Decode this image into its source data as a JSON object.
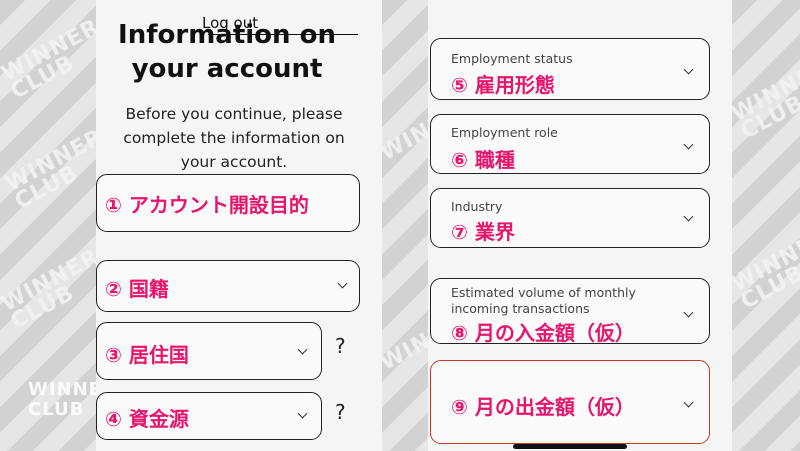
{
  "header": {
    "logout_label": "Log out",
    "title_line1": "Information on",
    "title_line2": "your account",
    "description": "Before you continue, please complete the information on your account."
  },
  "watermark": {
    "brand_lines": [
      "WINNER",
      "CLUB"
    ]
  },
  "left_fields": [
    {
      "marker": "①",
      "text": "アカウント開設目的"
    },
    {
      "marker": "②",
      "text": "国籍"
    },
    {
      "marker": "③",
      "text": "居住国",
      "help": "?"
    },
    {
      "marker": "④",
      "text": "資金源",
      "help": "?"
    }
  ],
  "right_fields": [
    {
      "label": "Employment status",
      "marker": "⑤",
      "text": "雇用形態"
    },
    {
      "label": "Employment role",
      "marker": "⑥",
      "text": "職種"
    },
    {
      "label": "Industry",
      "marker": "⑦",
      "text": "業界"
    },
    {
      "label": "Estimated volume of monthly incoming transactions",
      "marker": "⑧",
      "text": "月の入金額（仮）"
    },
    {
      "label": "",
      "marker": "⑨",
      "text": "月の出金額（仮）"
    }
  ],
  "colors": {
    "accent": "#e6156d",
    "highlight_border": "#c0392b",
    "panel": "#f5f5f5",
    "border": "#222222"
  }
}
